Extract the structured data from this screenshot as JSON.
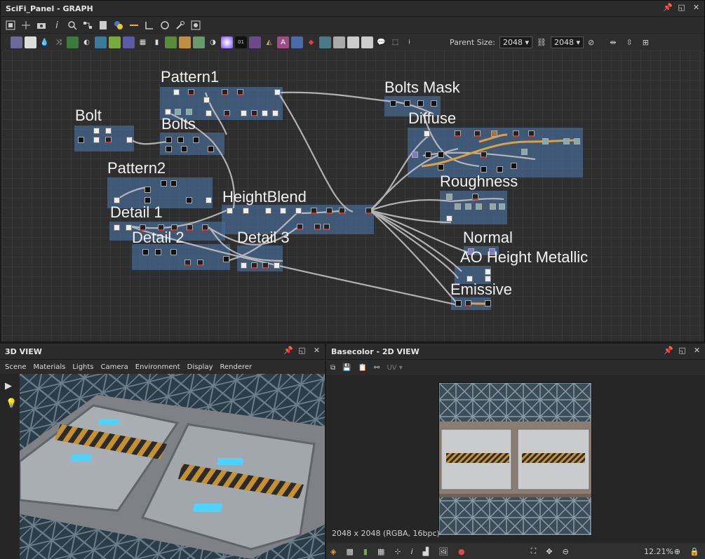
{
  "graph": {
    "title": "SciFi_Panel - GRAPH",
    "parent_size_label": "Parent Size:",
    "parent_size_w": "2048",
    "parent_size_h": "2048",
    "frames": [
      {
        "label": "Pattern1"
      },
      {
        "label": "Bolt"
      },
      {
        "label": "Bolts"
      },
      {
        "label": "Pattern2"
      },
      {
        "label": "Detail 1"
      },
      {
        "label": "Detail 2"
      },
      {
        "label": "HeightBlend"
      },
      {
        "label": "Detail 3"
      },
      {
        "label": "Bolts Mask"
      },
      {
        "label": "Diffuse"
      },
      {
        "label": "Roughness"
      },
      {
        "label": "Normal"
      },
      {
        "label": "AO Height Metallic"
      },
      {
        "label": "Emissive"
      }
    ]
  },
  "view3d": {
    "title": "3D VIEW",
    "menu": [
      "Scene",
      "Materials",
      "Lights",
      "Camera",
      "Environment",
      "Display",
      "Renderer"
    ]
  },
  "view2d": {
    "title": "Basecolor - 2D VIEW",
    "uv_label": "UV",
    "status": "2048 x 2048 (RGBA, 16bpc)",
    "zoom": "12.21%"
  },
  "colors": {
    "frame": "#46698f",
    "wire": "#c8c8c8",
    "wire_orange": "#e0a040",
    "glow": "#4fd2ff"
  }
}
